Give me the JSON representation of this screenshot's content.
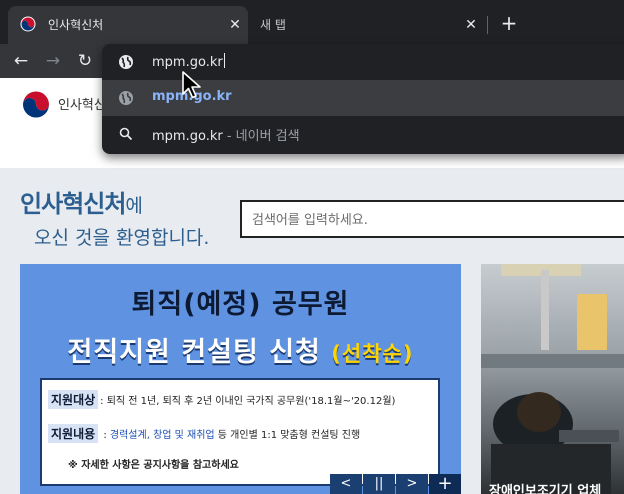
{
  "browser": {
    "tabs": [
      {
        "title": "인사혁신처",
        "active": true
      },
      {
        "title": "새 탭",
        "active": false
      }
    ],
    "new_tab_icon": "plus-icon",
    "omnibox": {
      "typed": "mpm.go.kr",
      "suggestions": [
        {
          "icon": "globe-icon",
          "text": "mpm.go.kr",
          "selected": true
        },
        {
          "icon": "search-icon",
          "text": "mpm.go.kr",
          "suffix": " - 네이버 검색",
          "selected": false
        }
      ]
    }
  },
  "site": {
    "logo_text": "인사혁신",
    "welcome_brand": "인사혁신처",
    "welcome_suffix": "에",
    "welcome_line2": "오신 것을 환영합니다.",
    "search_placeholder": "검색어를 입력하세요.",
    "banner": {
      "line1": "퇴직(예정) 공무원",
      "line2": "전직지원 컨설팅 신청",
      "line2_badge": "(선착순)",
      "target_label": "지원대상",
      "target_text": ": 퇴직 전 1년, 퇴직 후 2년 이내인 국가직 공무원('18.1월~'20.12월)",
      "content_label": "지원내용",
      "content_sep": " : ",
      "content_blue": "경력설계, 창업 및 재취업",
      "content_text": " 등 개인별 1:1 맞춤형 컨설팅 진행",
      "note": "※ 자세한 사항은 공지사항을 참고하세요"
    },
    "slider": {
      "prev": "<",
      "pause": "||",
      "next": ">",
      "more": "+"
    },
    "photo_caption": "장애인보조기기 업체"
  },
  "colors": {
    "accent": "#2c5e8f",
    "banner": "#5f93e1",
    "badge": "#ffd400"
  }
}
